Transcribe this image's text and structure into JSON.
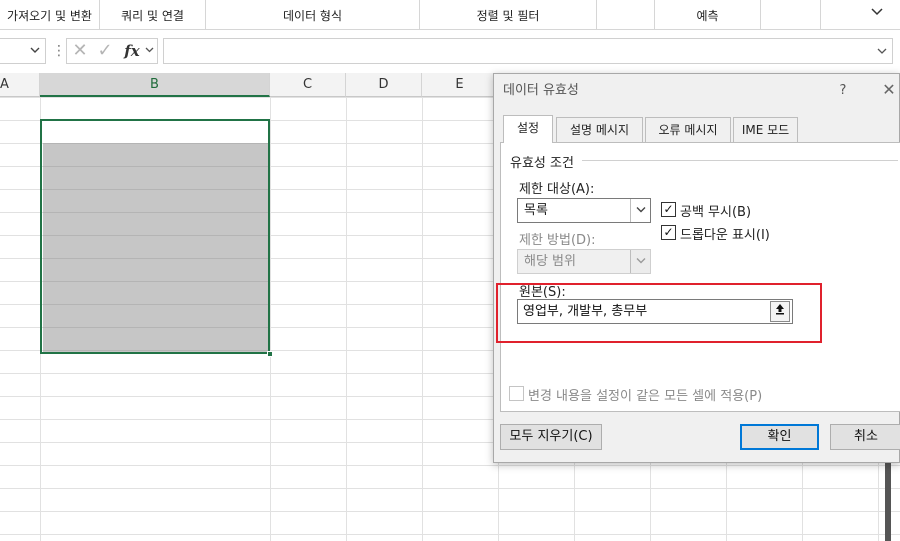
{
  "ribbon": {
    "groups": [
      "가져오기 및 변환",
      "쿼리 및 연결",
      "데이터 형식",
      "정렬 및 필터",
      "예측"
    ],
    "collapse_icon": "chevron-down-icon"
  },
  "formula_bar": {
    "fx_label": "fx",
    "cancel_icon": "✕",
    "enter_icon": "✓",
    "chevron": "⌄"
  },
  "columns": [
    "A",
    "B",
    "C",
    "D",
    "E"
  ],
  "dialog": {
    "title": "데이터 유효성",
    "help": "?",
    "close": "✕",
    "tabs": [
      "설정",
      "설명 메시지",
      "오류 메시지",
      "IME 모드"
    ],
    "active_tab": "설정",
    "section_title": "유효성 조건",
    "allow_label": "제한 대상(A):",
    "allow_value": "목록",
    "data_label": "제한 방법(D):",
    "data_value": "해당 범위",
    "ignore_blank": {
      "label": "공백 무시(B)",
      "checked": true
    },
    "in_cell_dropdown": {
      "label": "드롭다운 표시(I)",
      "checked": true
    },
    "source_label": "원본(S):",
    "source_value": "영업부, 개발부, 총무부",
    "apply_all": {
      "label": "변경 내용을 설정이 같은 모든 셀에 적용(P)",
      "checked": false
    },
    "clear_all": "모두 지우기(C)",
    "ok": "확인",
    "cancel": "취소"
  },
  "colors": {
    "selection": "#217346",
    "highlight_box": "#e0212d",
    "primary_button_border": "#0078d7"
  }
}
